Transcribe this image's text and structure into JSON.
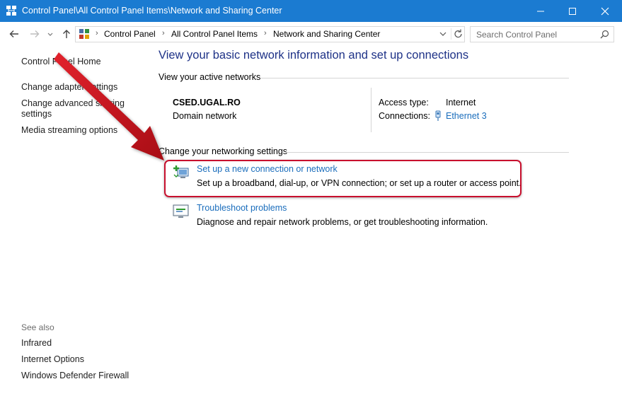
{
  "window": {
    "title": "Control Panel\\All Control Panel Items\\Network and Sharing Center"
  },
  "address": {
    "breadcrumbs": [
      "Control Panel",
      "All Control Panel Items",
      "Network and Sharing Center"
    ]
  },
  "search": {
    "placeholder": "Search Control Panel"
  },
  "sidebar": {
    "home": "Control Panel Home",
    "items": [
      "Change adapter settings",
      "Change advanced sharing settings",
      "Media streaming options"
    ],
    "see_also_label": "See also",
    "see_also": [
      "Infrared",
      "Internet Options",
      "Windows Defender Firewall"
    ]
  },
  "main": {
    "title": "View your basic network information and set up connections",
    "active_networks_label": "View your active networks",
    "network": {
      "name": "CSED.UGAL.RO",
      "type": "Domain network",
      "access_type_label": "Access type:",
      "access_type_value": "Internet",
      "connections_label": "Connections:",
      "connection_link": "Ethernet 3"
    },
    "change_settings_label": "Change your networking settings",
    "tasks": [
      {
        "link": "Set up a new connection or network",
        "description": "Set up a broadband, dial-up, or VPN connection; or set up a router or access point."
      },
      {
        "link": "Troubleshoot problems",
        "description": "Diagnose and repair network problems, or get troubleshooting information."
      }
    ]
  },
  "colors": {
    "titlebar": "#1b7bd1",
    "link": "#1a6dbc",
    "heading": "#1e3287",
    "highlight": "#c8102e"
  }
}
